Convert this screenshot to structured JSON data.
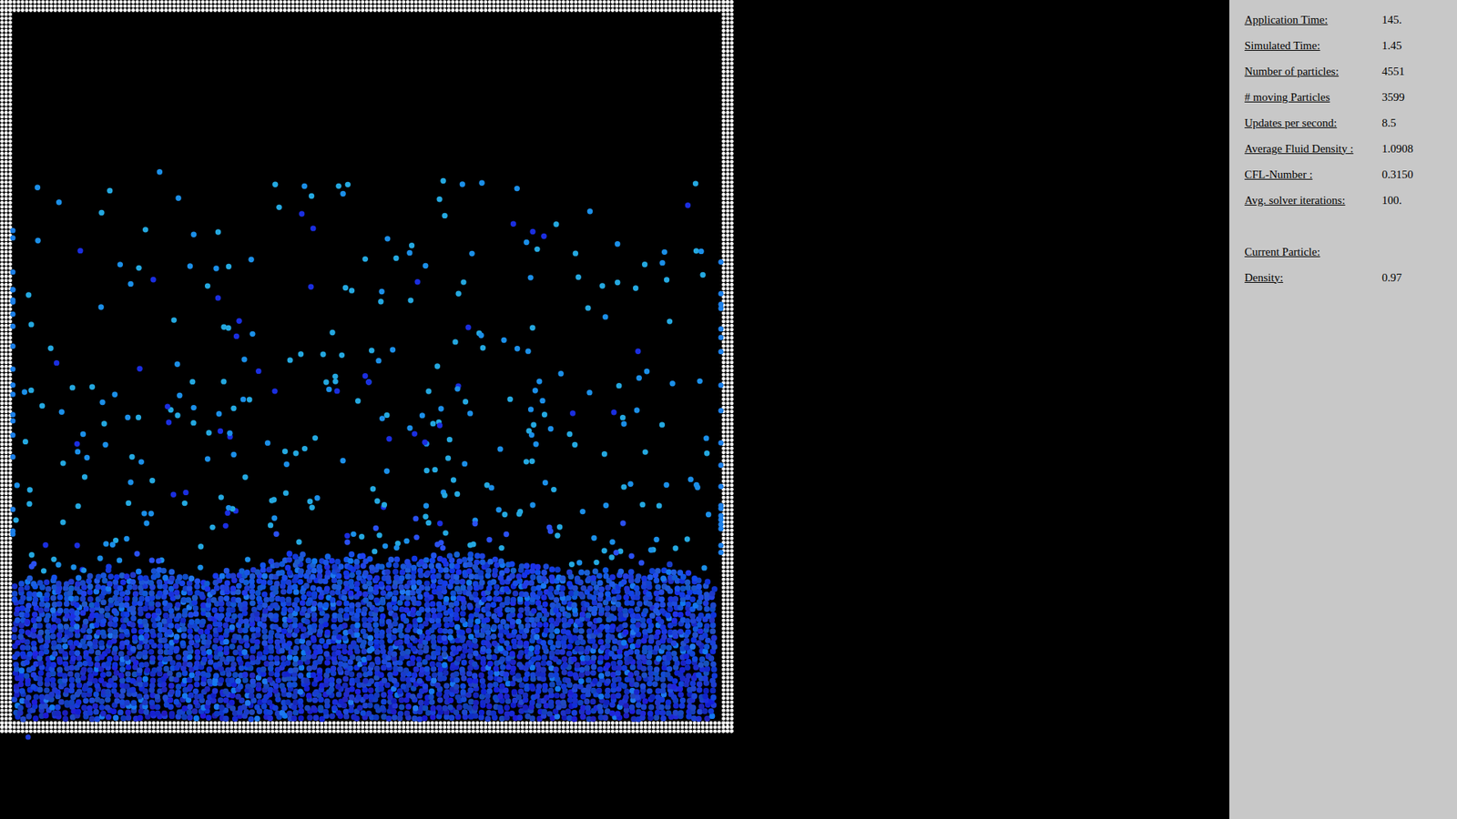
{
  "panel": {
    "stats": [
      {
        "label": "Application Time:",
        "value": "145."
      },
      {
        "label": "Simulated Time:",
        "value": "1.45"
      },
      {
        "label": "Number of particles:",
        "value": "4551"
      },
      {
        "label": "# moving Particles",
        "value": "3599"
      },
      {
        "label": "Updates per second:",
        "value": "8.5"
      },
      {
        "label": "Average Fluid Density :",
        "value": "1.0908"
      },
      {
        "label": "CFL-Number :",
        "value": "0.3150"
      },
      {
        "label": "Avg. solver iterations:",
        "value": "100."
      }
    ],
    "current_particle": {
      "heading": "Current Particle:",
      "rows": [
        {
          "label": "Density:",
          "value": "0.97"
        }
      ]
    }
  }
}
